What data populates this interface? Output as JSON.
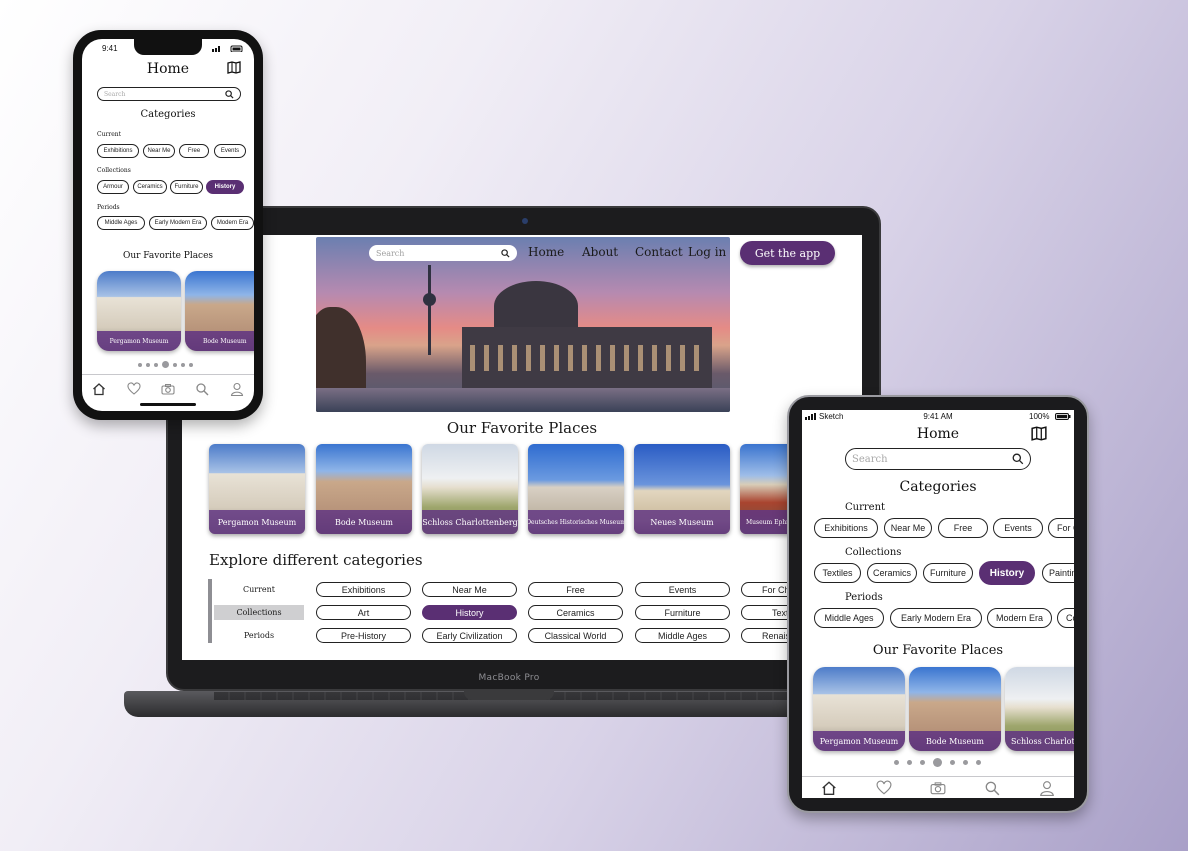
{
  "web": {
    "search_placeholder": "Search",
    "nav": [
      "Home",
      "About",
      "Contact",
      "Log in"
    ],
    "cta": "Get the app",
    "favorites_title": "Our Favorite Places",
    "places": [
      "Pergamon Museum",
      "Bode Museum",
      "Schloss Charlottenberg",
      "Deutsches Historisches Museum",
      "Neues Museum",
      "Museum Ephraim-Palais"
    ],
    "explore_title": "Explore different categories",
    "rows": [
      {
        "label": "Current",
        "chips": [
          "Exhibitions",
          "Near Me",
          "Free",
          "Events",
          "For Children"
        ]
      },
      {
        "label": "Collections",
        "chips": [
          "Art",
          "History",
          "Ceramics",
          "Furniture",
          "Textiles"
        ]
      },
      {
        "label": "Periods",
        "chips": [
          "Pre-History",
          "Early Civilization",
          "Classical World",
          "Middle Ages",
          "Renaissance"
        ]
      }
    ],
    "device_label": "MacBook Pro"
  },
  "phone": {
    "time": "9:41",
    "title": "Home",
    "search_placeholder": "Search",
    "categories_title": "Categories",
    "current_label": "Current",
    "current_chips": [
      "Exhibitions",
      "Near Me",
      "Free",
      "Events"
    ],
    "collections_label": "Collections",
    "collections_chips": [
      "Armour",
      "Ceramics",
      "Furniture",
      "History"
    ],
    "periods_label": "Periods",
    "periods_chips": [
      "Middle Ages",
      "Early Modern Era",
      "Modern Era"
    ],
    "favorites_title": "Our Favorite Places",
    "places": [
      "Pergamon Museum",
      "Bode Museum"
    ]
  },
  "tablet": {
    "carrier": "Sketch",
    "time": "9:41 AM",
    "battery": "100%",
    "title": "Home",
    "search_placeholder": "Search",
    "categories_title": "Categories",
    "current_label": "Current",
    "current_chips": [
      "Exhibitions",
      "Near Me",
      "Free",
      "Events",
      "For Children"
    ],
    "collections_label": "Collections",
    "collections_chips": [
      "Textiles",
      "Ceramics",
      "Furniture",
      "History",
      "Painting"
    ],
    "periods_label": "Periods",
    "periods_chips": [
      "Middle Ages",
      "Early Modern Era",
      "Modern Era",
      "Contemporary"
    ],
    "favorites_title": "Our Favorite Places",
    "places": [
      "Pergamon Museum",
      "Bode Museum",
      "Schloss Charlottenberg"
    ]
  },
  "theme": {
    "accent": "#5a2f73",
    "chip_border": "#222222"
  },
  "icons": [
    "search-icon",
    "map-icon",
    "home-icon",
    "heart-icon",
    "camera-icon",
    "profile-icon"
  ]
}
